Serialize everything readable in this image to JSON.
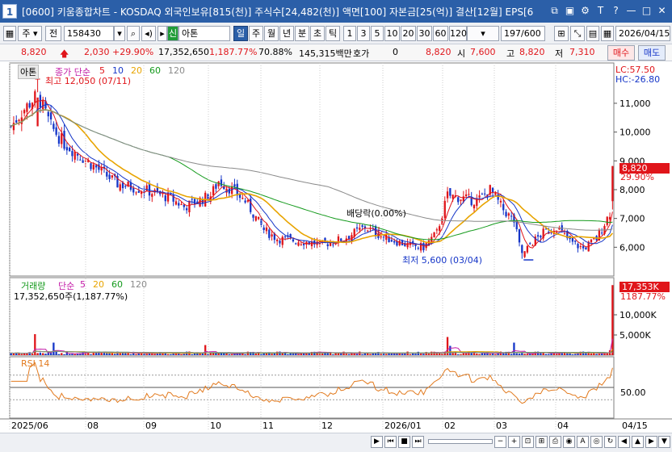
{
  "title": {
    "number": "1",
    "text": "[0600] 키움종합차트 - KOSDAQ 외국인보유[815(천)] 주식수[24,482(천)] 액면[100] 자본금[25(억)] 결산[12월] EPS[6"
  },
  "toolbar": {
    "period_type": "주",
    "period_prefix": "전",
    "code": "158430",
    "name_badge": "신",
    "stock_name": "아톤",
    "periods": [
      "일",
      "주",
      "월",
      "년",
      "분",
      "초",
      "틱"
    ],
    "active_period": "일",
    "intervals": [
      "1",
      "3",
      "5",
      "10",
      "20",
      "30",
      "60",
      "120"
    ],
    "count": "197/600",
    "date": "2026/04/15"
  },
  "quote": {
    "price": "8,820",
    "change": "2,030",
    "change_pct": "+29.90%",
    "volume": "17,352,650",
    "volume_pct": "1,187.77%",
    "ratio": "70.88%",
    "amount": "145,315백만",
    "hoga_label": "호가",
    "hoga": "0",
    "hoga_price": "8,820",
    "open_label": "시",
    "open": "7,600",
    "high_label": "고",
    "high": "8,820",
    "low_label": "저",
    "low": "7,310",
    "buy_label": "매수",
    "sell_label": "매도"
  },
  "price_panel": {
    "stock_tag": "아톤",
    "ma_title": "종가 단순",
    "ma_periods": [
      "5",
      "10",
      "20",
      "60",
      "120"
    ],
    "ma_colors": [
      "#e0151a",
      "#1636c8",
      "#e8a400",
      "#149a1c",
      "#8a8a8a"
    ],
    "high_note": "최고 12,050 (07/11)",
    "low_note": "최저 5,600 (03/04)",
    "dividend_note": "배당락(0.00%)",
    "lc": "LC:57.50",
    "hc": "HC:-26.80",
    "last_price": "8,820",
    "last_pct": "29.90%"
  },
  "volume_panel": {
    "title": "거래량",
    "ma_title": "단순",
    "ma_periods": [
      "5",
      "20",
      "60",
      "120"
    ],
    "volume_text": "17,352,650주(1,187.77%)",
    "last": "17,353K",
    "last_pct": "1187.77%"
  },
  "rsi_panel": {
    "title": "RSI 14",
    "level": "50.00"
  },
  "chart_data": {
    "type": "candlestick",
    "x_labels": [
      "2025/06",
      "08",
      "09",
      "10",
      "11",
      "12",
      "2026/01",
      "02",
      "03",
      "04",
      "04/15"
    ],
    "price_axis": [
      "11,000",
      "10,000",
      "9,000",
      "8,000",
      "7,000",
      "6,000"
    ],
    "volume_axis": [
      "10,000K",
      "5,000K"
    ],
    "ylim": [
      5000,
      12400
    ],
    "high": 12050,
    "low": 5600,
    "last": 8820,
    "anchors": [
      [
        0,
        10200
      ],
      [
        5,
        10800
      ],
      [
        10,
        11300
      ],
      [
        15,
        10200
      ],
      [
        20,
        9600
      ],
      [
        30,
        8900
      ],
      [
        40,
        8200
      ],
      [
        50,
        8000
      ],
      [
        60,
        7700
      ],
      [
        65,
        7400
      ],
      [
        75,
        7800
      ],
      [
        78,
        8300
      ],
      [
        83,
        8000
      ],
      [
        88,
        7600
      ],
      [
        95,
        6600
      ],
      [
        100,
        6300
      ],
      [
        110,
        6200
      ],
      [
        117,
        6100
      ],
      [
        125,
        6300
      ],
      [
        133,
        6700
      ],
      [
        140,
        6350
      ],
      [
        150,
        6050
      ],
      [
        155,
        6000
      ],
      [
        160,
        6500
      ],
      [
        164,
        7800
      ],
      [
        170,
        7700
      ],
      [
        175,
        7600
      ],
      [
        180,
        8000
      ],
      [
        185,
        7300
      ],
      [
        189,
        6900
      ],
      [
        192,
        5650
      ],
      [
        195,
        6100
      ],
      [
        200,
        6500
      ],
      [
        205,
        6700
      ],
      [
        210,
        6200
      ],
      [
        215,
        5950
      ],
      [
        220,
        6300
      ],
      [
        225,
        7200
      ],
      [
        226,
        8820
      ]
    ]
  }
}
